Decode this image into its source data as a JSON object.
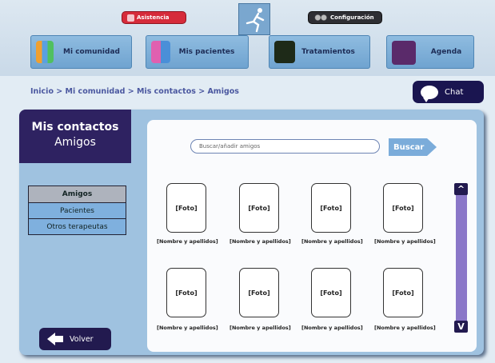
{
  "top": {
    "assistance_label": "Asistencia",
    "config_label": "Configuración"
  },
  "nav": {
    "community": "Mi comunidad",
    "patients": "Mis pacientes",
    "treatments": "Tratamientos",
    "agenda": "Agenda"
  },
  "breadcrumb": "Inicio > Mi comunidad > Mis contactos > Amigos",
  "chat_label": "Chat",
  "section": {
    "title": "Mis contactos",
    "subtitle": "Amigos"
  },
  "search": {
    "placeholder": "Buscar/añadir amigos",
    "button": "Buscar"
  },
  "tabs": [
    "Amigos",
    "Pacientes",
    "Otros terapeutas"
  ],
  "back_label": "Volver",
  "cards": {
    "photo": "[Foto]",
    "name": "[Nombre y apellidos]"
  },
  "scroll": {
    "up": "^",
    "down": "V"
  }
}
